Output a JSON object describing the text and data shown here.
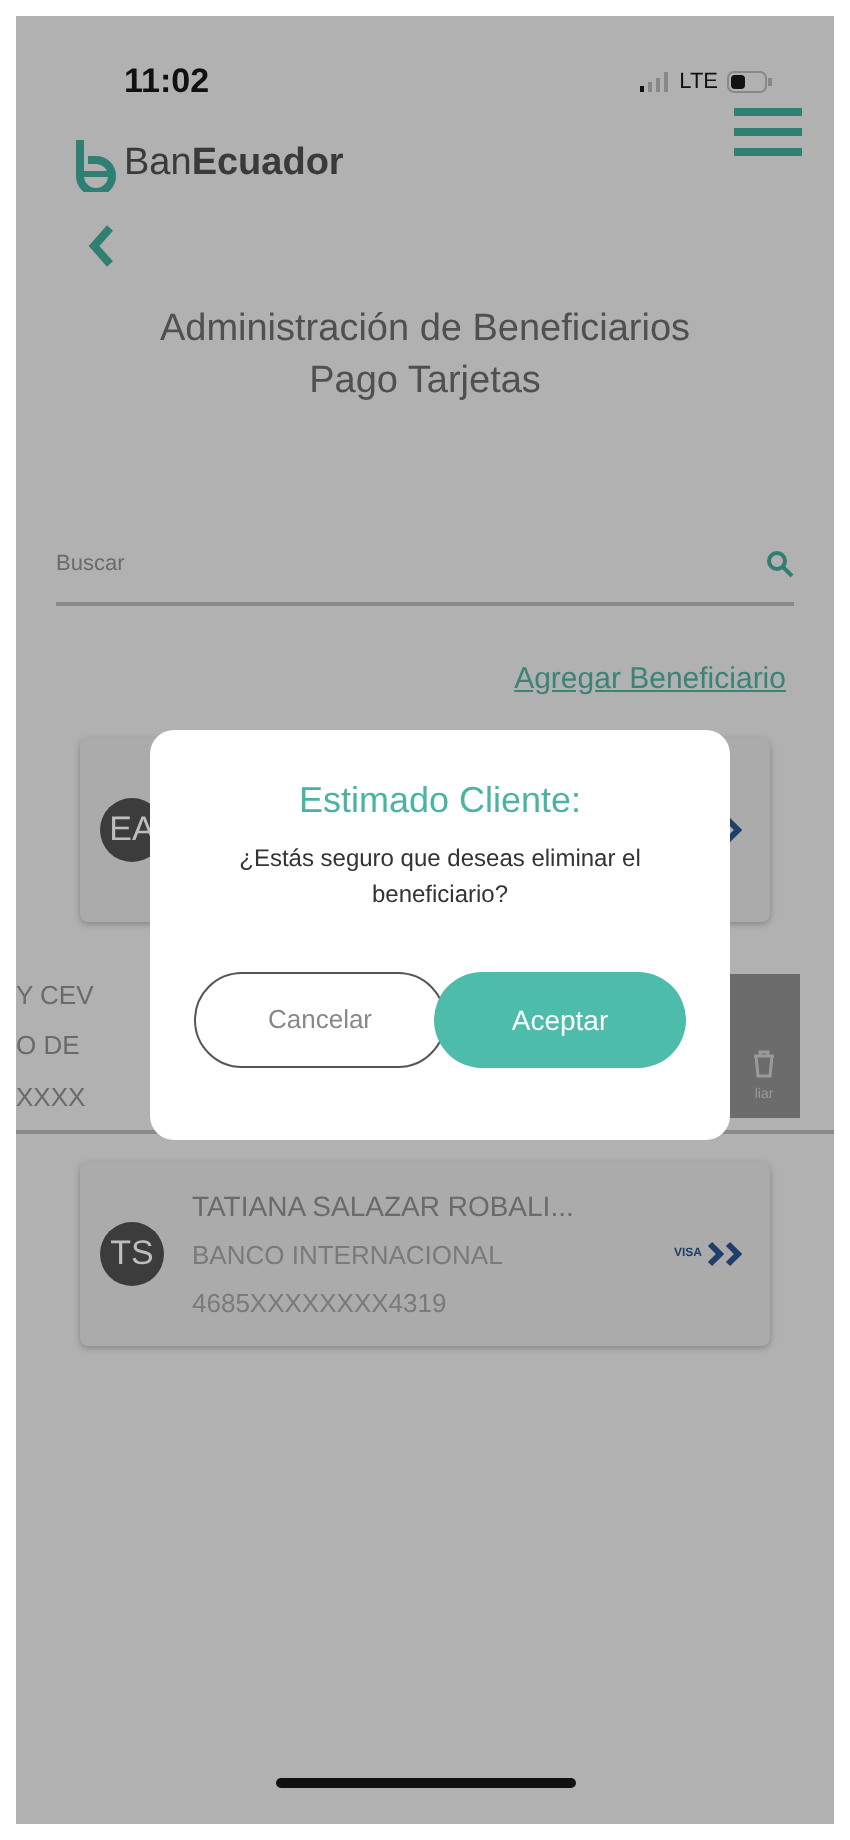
{
  "status_bar": {
    "time": "11:02",
    "network": "LTE"
  },
  "header": {
    "logo": "Ban**Ecuador**"
  },
  "title": [
    "Administración de Beneficiarios",
    "Pago Tarjetas"
  ],
  "search": {
    "placeholder": "Buscar"
  },
  "add_link": "Agregar Beneficiario",
  "beneficiaries": [
    {
      "kind": "card",
      "initials": "EA"
    },
    {
      "kind": "swiped",
      "lines": [
        "Y CEV",
        "O DE",
        "XXXX"
      ],
      "action": "liar"
    },
    {
      "kind": "card",
      "initials": "TS",
      "name": "TATIANA SALAZAR ROBALI...",
      "bank": "BANCO INTERNACIONAL",
      "card_number": "4685XXXXXXXX4319",
      "brand": "VISA"
    }
  ],
  "dialog": {
    "title": "Estimado Cliente:",
    "message": "¿Estás seguro que deseas eliminar el beneficiario?",
    "buttons": [
      {
        "kind": "secondary",
        "label": "Cancelar"
      },
      {
        "kind": "primary",
        "label": "Aceptar"
      }
    ]
  }
}
